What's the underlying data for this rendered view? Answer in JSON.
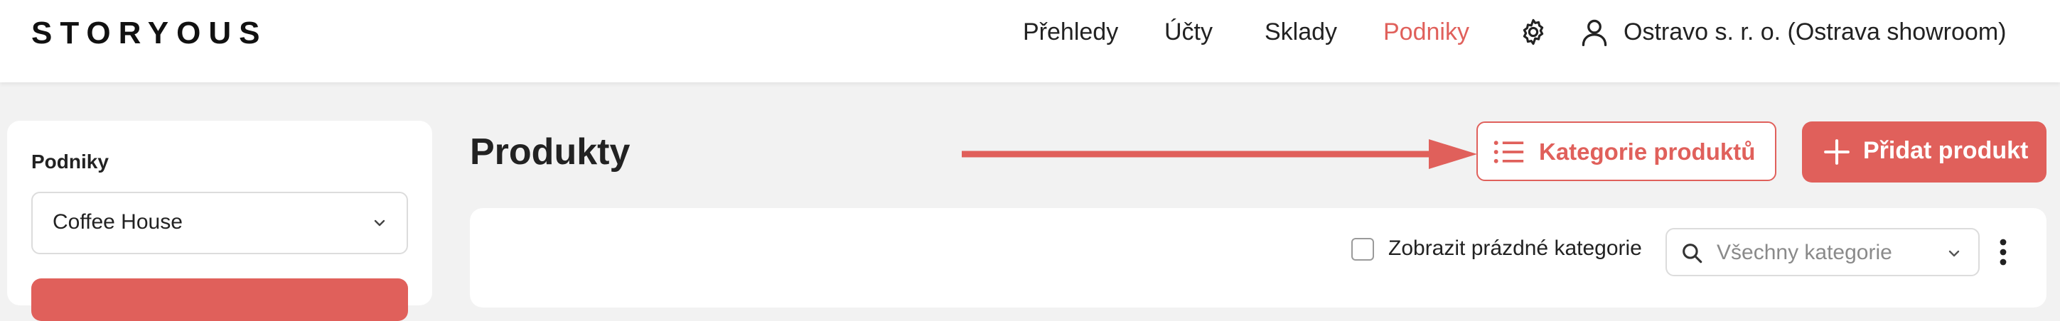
{
  "header": {
    "logo": "STORYOUS",
    "nav": [
      {
        "label": "Přehledy",
        "active": false
      },
      {
        "label": "Účty",
        "active": false
      },
      {
        "label": "Sklady",
        "active": false
      },
      {
        "label": "Podniky",
        "active": true
      }
    ],
    "settings_icon": "gear-icon",
    "user_icon": "user-icon",
    "account": "Ostravo s. r. o. (Ostrava showroom)"
  },
  "sidebar": {
    "label": "Podniky",
    "venue_select": {
      "value": "Coffee House"
    }
  },
  "main": {
    "title": "Produkty",
    "categories_button": "Kategorie produktů",
    "add_button": "Přidat produkt",
    "filters": {
      "show_empty_label": "Zobrazit prázdné kategorie",
      "show_empty_checked": false,
      "category_placeholder": "Všechny kategorie"
    }
  },
  "colors": {
    "accent": "#e0605b",
    "background": "#f2f2f2",
    "surface": "#ffffff"
  }
}
